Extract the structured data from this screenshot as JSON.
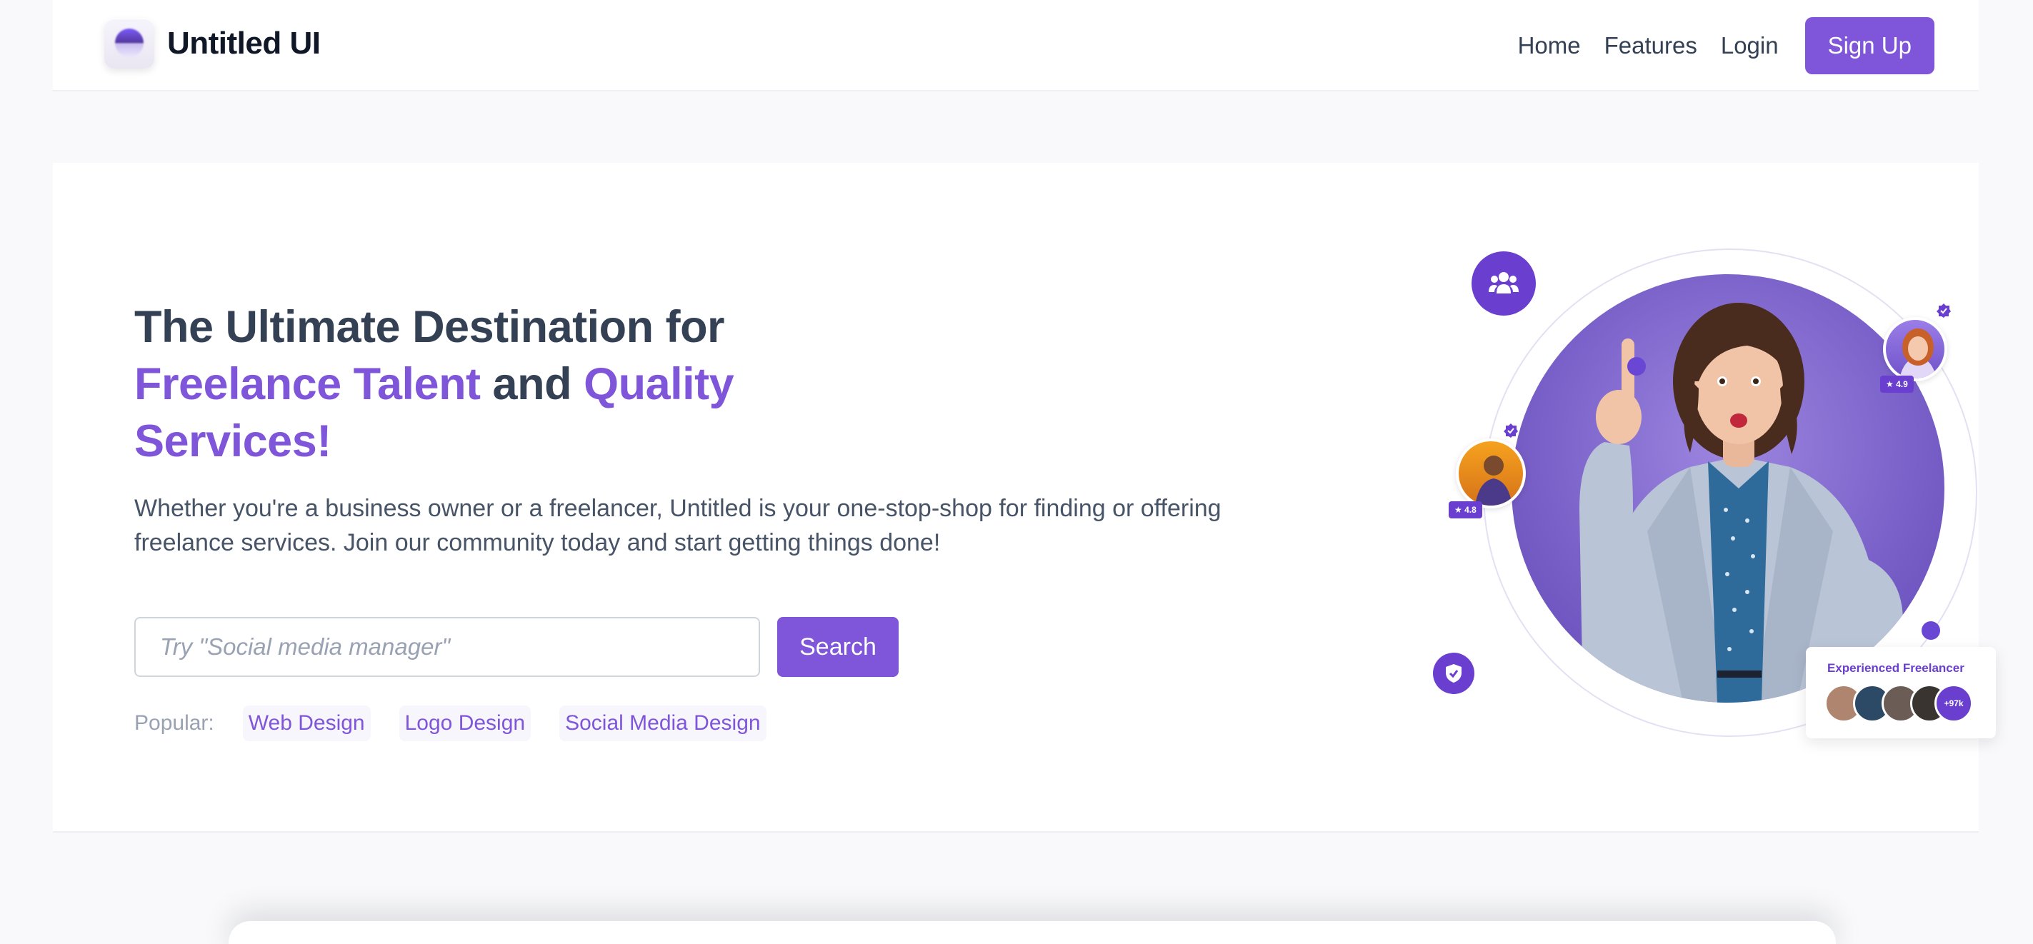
{
  "brand": {
    "name": "Untitled UI"
  },
  "nav": {
    "items": [
      {
        "label": "Home"
      },
      {
        "label": "Features"
      },
      {
        "label": "Login"
      }
    ],
    "signup_label": "Sign Up"
  },
  "hero": {
    "title_line1": "The Ultimate Destination for",
    "title_accent1": "Freelance Talent",
    "title_and": "and",
    "title_accent2": "Quality",
    "title_accent3": "Services!",
    "description": "Whether you're a business owner or a freelancer, Untitled is your one-stop-shop for finding or offering freelance services. Join our community today and start getting things done!",
    "search": {
      "placeholder": "Try \"Social media manager\"",
      "button_label": "Search"
    },
    "popular": {
      "label": "Popular:",
      "tags": [
        "Web Design",
        "Logo Design",
        "Social Media Design"
      ]
    }
  },
  "art": {
    "rating_top": "4.9",
    "rating_left": "4.8",
    "card_title": "Experienced Freelancer",
    "more_count": "+97k"
  },
  "colors": {
    "accent": "#7f56d9",
    "deep_accent": "#6a3fd0",
    "text": "#344054"
  }
}
